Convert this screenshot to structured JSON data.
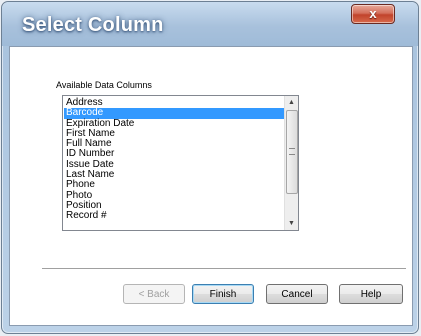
{
  "window": {
    "title": "Select Column",
    "close_glyph": "x"
  },
  "available_columns": {
    "label": "Available Data Columns",
    "items": [
      {
        "label": "Address",
        "selected": false
      },
      {
        "label": "Barcode",
        "selected": true
      },
      {
        "label": "Expiration Date",
        "selected": false
      },
      {
        "label": "First Name",
        "selected": false
      },
      {
        "label": "Full Name",
        "selected": false
      },
      {
        "label": "ID Number",
        "selected": false
      },
      {
        "label": "Issue Date",
        "selected": false
      },
      {
        "label": "Last Name",
        "selected": false
      },
      {
        "label": "Phone",
        "selected": false
      },
      {
        "label": "Photo",
        "selected": false
      },
      {
        "label": "Position",
        "selected": false
      },
      {
        "label": "Record #",
        "selected": false
      }
    ],
    "scroll_up_glyph": "▲",
    "scroll_down_glyph": "▼"
  },
  "buttons": {
    "back": "< Back",
    "finish": "Finish",
    "cancel": "Cancel",
    "help": "Help"
  },
  "colors": {
    "selection": "#3399ff",
    "close_button": "#c1432b"
  }
}
